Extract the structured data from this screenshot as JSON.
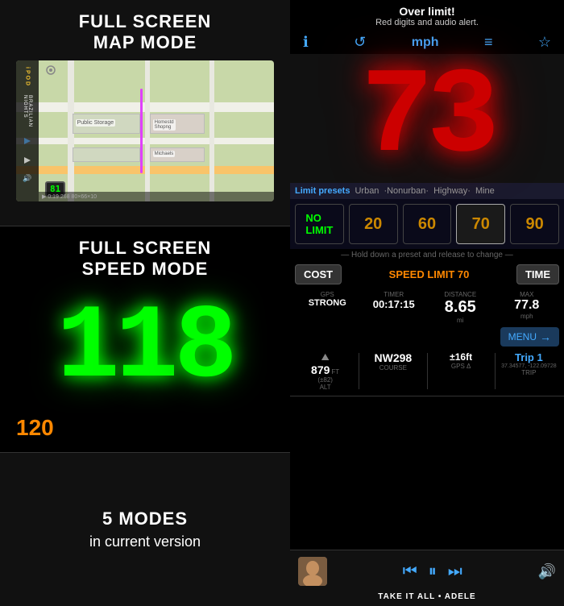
{
  "left": {
    "map_section": {
      "title_line1": "FULL SCREEN",
      "title_line2": "MAP MODE",
      "speed_badge": "81",
      "info_bar": "▶ 0:19  268   80×66×10"
    },
    "speed_section": {
      "title_line1": "FULL SCREEN",
      "title_line2": "SPEED MODE",
      "digits": "118",
      "speed_limit": "120"
    },
    "modes_section": {
      "title_line1": "5 MODES",
      "title_line2": "in current version"
    }
  },
  "right": {
    "header": {
      "over_limit": "Over limit!",
      "subtitle": "Red digits and audio alert.",
      "toolbar": {
        "info_icon": "ℹ",
        "refresh_icon": "↺",
        "mph": "mph",
        "menu_icon": "≡",
        "star_icon": "☆"
      }
    },
    "speed_display": {
      "value": "73"
    },
    "limit_presets": {
      "label": "Limit presets",
      "items": [
        "Urban",
        "·Nonurban·",
        "Highway·",
        "Mine"
      ]
    },
    "presets": {
      "boxes": [
        {
          "label": "NO\nLIMIT",
          "type": "no-limit"
        },
        {
          "label": "20",
          "type": "num"
        },
        {
          "label": "60",
          "type": "num"
        },
        {
          "label": "70",
          "type": "num active"
        },
        {
          "label": "90",
          "type": "num"
        }
      ]
    },
    "hold_text": "— Hold down a preset and release to change —",
    "cost_time": {
      "cost_label": "COST",
      "speed_limit_text": "SPEED LIMIT 70",
      "time_label": "TIME"
    },
    "gps_info": {
      "gps_label": "GPS",
      "gps_value": "STRONG",
      "timer_label": "TIMER",
      "timer_value": "00:17:15",
      "distance_label": "DISTANCE",
      "distance_value": "8.65",
      "distance_unit": "mi",
      "max_label": "MAX",
      "max_value": "77.8",
      "max_unit": "mph",
      "menu_label": "MENU",
      "menu_arrow": "→"
    },
    "alt_row": {
      "alt_icon": "⛰",
      "alt_label": "ft",
      "alt_value": "879",
      "alt_sub": "(±82)",
      "alt_label2": "ALT",
      "course_value": "NW298",
      "course_label": "COURSE",
      "gps_delta_value": "±16ft",
      "gps_delta_label": "GPS Δ",
      "trip_label": "Trip 1",
      "trip_coords": "37.34577, -122.09728",
      "trip_section_label": "TRIP"
    },
    "player": {
      "track": "TAKE IT ALL • ADELE",
      "prev_icon": "⏮",
      "pause_icon": "⏸",
      "next_icon": "⏭",
      "vol_icon": "🔊"
    }
  }
}
